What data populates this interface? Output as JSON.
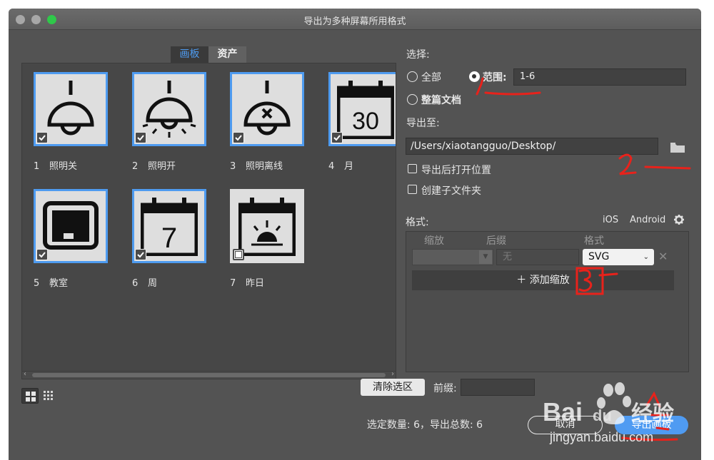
{
  "window": {
    "title": "导出为多种屏幕所用格式"
  },
  "tabs": [
    {
      "label": "画板",
      "active": true
    },
    {
      "label": "资产",
      "active": false
    }
  ],
  "artboards": [
    {
      "num": "1",
      "name": "照明关",
      "checked": true,
      "icon": "lamp-off-icon"
    },
    {
      "num": "2",
      "name": "照明开",
      "checked": true,
      "icon": "lamp-on-icon"
    },
    {
      "num": "3",
      "name": "照明离线",
      "checked": true,
      "icon": "lamp-offline-icon"
    },
    {
      "num": "4",
      "name": "月",
      "checked": true,
      "icon": "calendar-30-icon"
    },
    {
      "num": "5",
      "name": "教室",
      "checked": true,
      "icon": "classroom-board-icon"
    },
    {
      "num": "6",
      "name": "周",
      "checked": true,
      "icon": "calendar-7-icon"
    },
    {
      "num": "7",
      "name": "昨日",
      "checked": false,
      "icon": "calendar-sunset-icon"
    }
  ],
  "calendar_numbers": {
    "month": "30",
    "week": "7"
  },
  "select": {
    "label": "选择:",
    "all_label": "全部",
    "range_label": "范围:",
    "range_value": "1-6",
    "whole_doc_label": "整篇文档",
    "selected_option": "range"
  },
  "export_to": {
    "label": "导出至:",
    "path": "/Users/xiaotangguo/Desktop/",
    "open_after_label": "导出后打开位置",
    "create_subfolder_label": "创建子文件夹"
  },
  "formats": {
    "label": "格式:",
    "ios_label": "iOS",
    "android_label": "Android",
    "col_scale": "缩放",
    "col_suffix": "后缀",
    "col_format": "格式",
    "suffix_placeholder": "无",
    "format_value": "SVG",
    "add_scale_label": "添加缩放"
  },
  "bottom": {
    "clear_selection_label": "清除选区",
    "prefix_label": "前缀:",
    "summary": "选定数量: 6，导出总数: 6",
    "cancel_label": "取消",
    "export_label": "导出画板"
  },
  "watermark": {
    "brand": "Bai",
    "brand2": "du",
    "cn": "经验",
    "url": "jingyan.baidu.com"
  },
  "colors": {
    "accent": "#4e9bf0",
    "annotation": "#e8221b",
    "panel": "#535353"
  }
}
